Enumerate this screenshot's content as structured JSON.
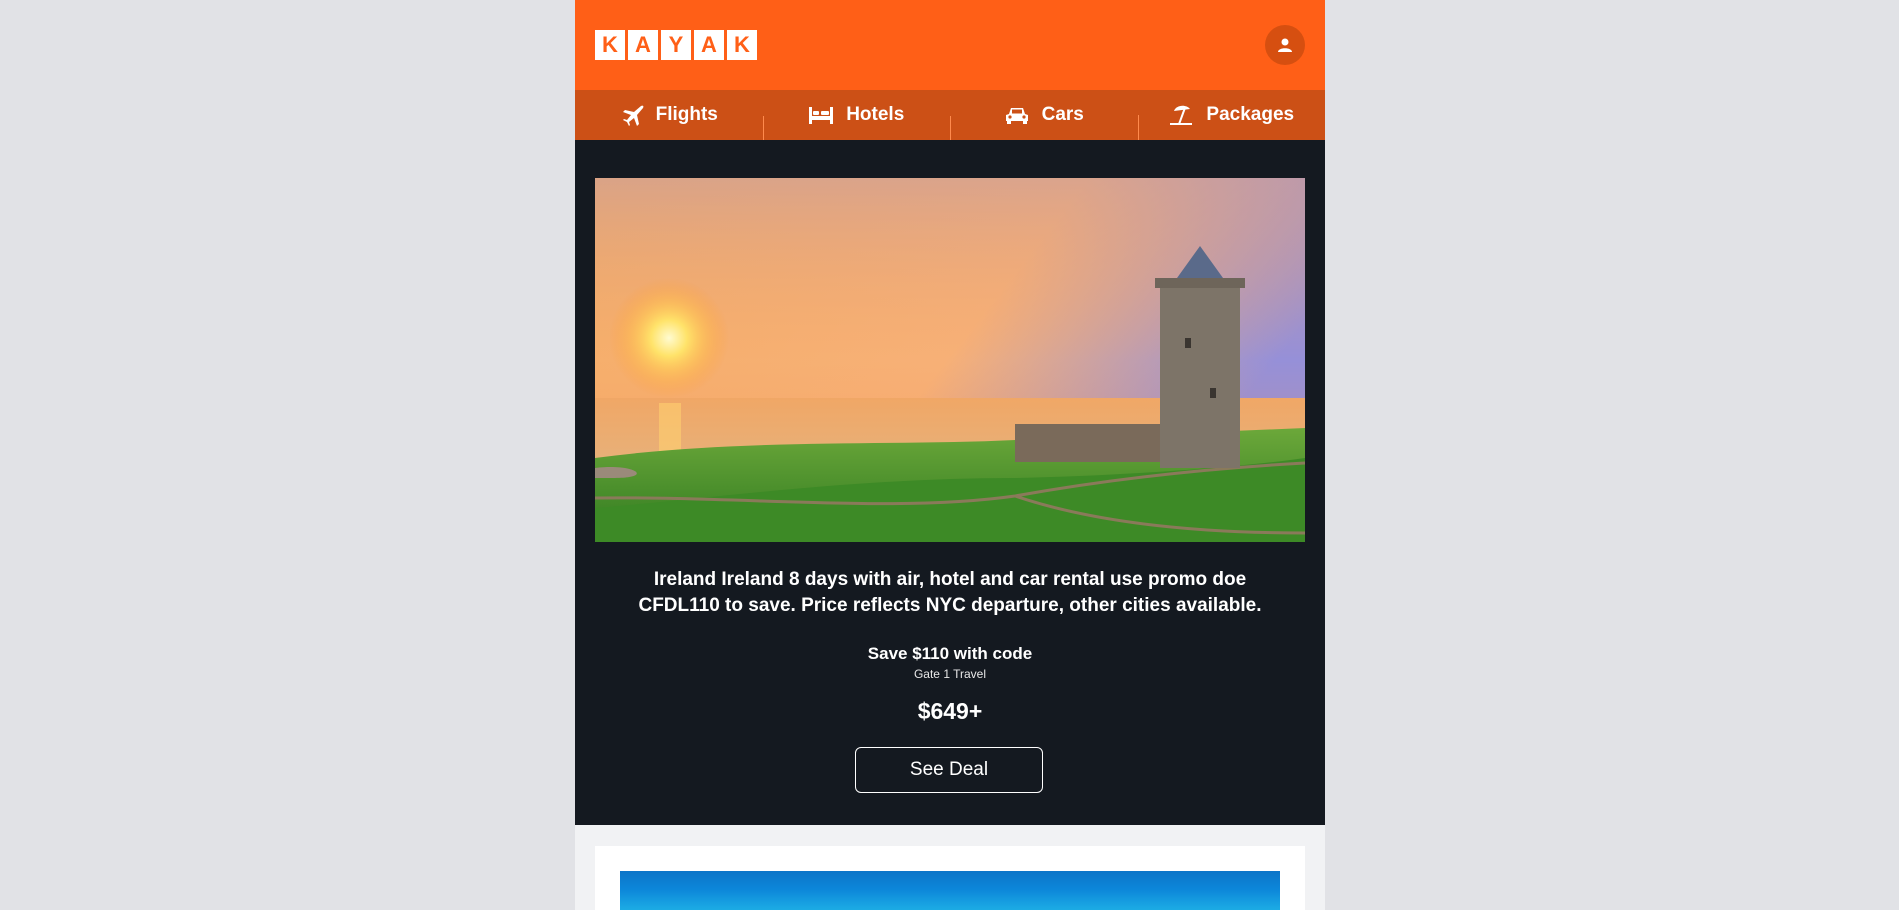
{
  "brand": {
    "letters": [
      "K",
      "A",
      "Y",
      "A",
      "K"
    ]
  },
  "header": {
    "account_icon": "user-icon"
  },
  "nav": {
    "items": [
      {
        "label": "Flights",
        "icon": "plane-icon"
      },
      {
        "label": "Hotels",
        "icon": "bed-icon"
      },
      {
        "label": "Cars",
        "icon": "car-icon"
      },
      {
        "label": "Packages",
        "icon": "beach-umbrella-icon"
      }
    ]
  },
  "deal": {
    "headline": "Ireland Ireland 8 days with air, hotel and car rental use promo doe CFDL110 to save. Price reflects NYC departure, other cities available.",
    "save_text": "Save $110 with code",
    "vendor": "Gate 1 Travel",
    "price": "$649+",
    "cta": "See Deal"
  },
  "colors": {
    "brand": "#ff5f17",
    "nav": "#cc5016",
    "hero_bg": "#141920"
  }
}
